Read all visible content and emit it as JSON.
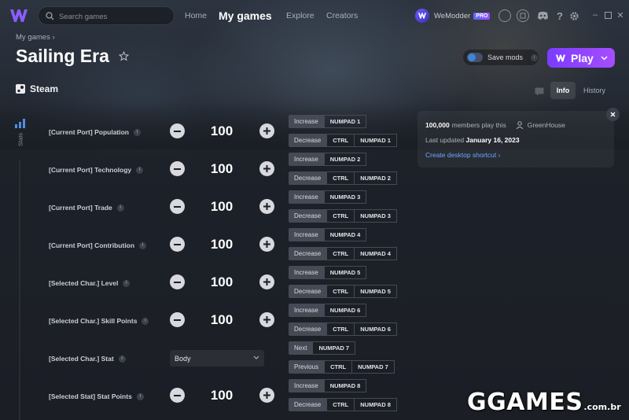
{
  "search": {
    "placeholder": "Search games"
  },
  "nav": {
    "home": "Home",
    "my_games": "My games",
    "explore": "Explore",
    "creators": "Creators"
  },
  "account": {
    "name": "WeModder",
    "badge": "PRO"
  },
  "breadcrumb": "My games ›",
  "game": {
    "title": "Sailing Era",
    "platform": "Steam"
  },
  "actions": {
    "save_mods": "Save mods",
    "play": "Play"
  },
  "panel_tabs": {
    "info": "Info",
    "history": "History"
  },
  "sidebar": {
    "stats_label": "Stats"
  },
  "cheats": [
    {
      "name": "[Current Port] Population",
      "type": "number",
      "value": "100",
      "hotkeys": [
        {
          "action": "Increase",
          "keys": [
            "NUMPAD 1"
          ]
        },
        {
          "action": "Decrease",
          "keys": [
            "CTRL",
            "NUMPAD 1"
          ]
        }
      ]
    },
    {
      "name": "[Current Port] Technology",
      "type": "number",
      "value": "100",
      "hotkeys": [
        {
          "action": "Increase",
          "keys": [
            "NUMPAD 2"
          ]
        },
        {
          "action": "Decrease",
          "keys": [
            "CTRL",
            "NUMPAD 2"
          ]
        }
      ]
    },
    {
      "name": "[Current Port] Trade",
      "type": "number",
      "value": "100",
      "hotkeys": [
        {
          "action": "Increase",
          "keys": [
            "NUMPAD 3"
          ]
        },
        {
          "action": "Decrease",
          "keys": [
            "CTRL",
            "NUMPAD 3"
          ]
        }
      ]
    },
    {
      "name": "[Current Port] Contribution",
      "type": "number",
      "value": "100",
      "hotkeys": [
        {
          "action": "Increase",
          "keys": [
            "NUMPAD 4"
          ]
        },
        {
          "action": "Decrease",
          "keys": [
            "CTRL",
            "NUMPAD 4"
          ]
        }
      ]
    },
    {
      "name": "[Selected Char.] Level",
      "type": "number",
      "value": "100",
      "hotkeys": [
        {
          "action": "Increase",
          "keys": [
            "NUMPAD 5"
          ]
        },
        {
          "action": "Decrease",
          "keys": [
            "CTRL",
            "NUMPAD 5"
          ]
        }
      ]
    },
    {
      "name": "[Selected Char.] Skill Points",
      "type": "number",
      "value": "100",
      "hotkeys": [
        {
          "action": "Increase",
          "keys": [
            "NUMPAD 6"
          ]
        },
        {
          "action": "Decrease",
          "keys": [
            "CTRL",
            "NUMPAD 6"
          ]
        }
      ]
    },
    {
      "name": "[Selected Char.] Stat",
      "type": "select",
      "value": "Body",
      "hotkeys": [
        {
          "action": "Next",
          "keys": [
            "NUMPAD 7"
          ]
        },
        {
          "action": "Previous",
          "keys": [
            "CTRL",
            "NUMPAD 7"
          ]
        }
      ]
    },
    {
      "name": "[Selected Stat] Stat Points",
      "type": "number",
      "value": "100",
      "hotkeys": [
        {
          "action": "Increase",
          "keys": [
            "NUMPAD 8"
          ]
        },
        {
          "action": "Decrease",
          "keys": [
            "CTRL",
            "NUMPAD 8"
          ]
        }
      ]
    }
  ],
  "info_card": {
    "players_count": "100,000",
    "players_text": "members play this",
    "author": "GreenHouse",
    "updated_label": "Last updated",
    "updated_date": "January 16, 2023",
    "shortcut_link": "Create desktop shortcut ›"
  },
  "watermark": {
    "main": "GGAMES",
    "suffix": ".com.br"
  },
  "colors": {
    "accent": "#8a44ff",
    "link": "#6fa6ff",
    "key_bg": "#454a55"
  }
}
